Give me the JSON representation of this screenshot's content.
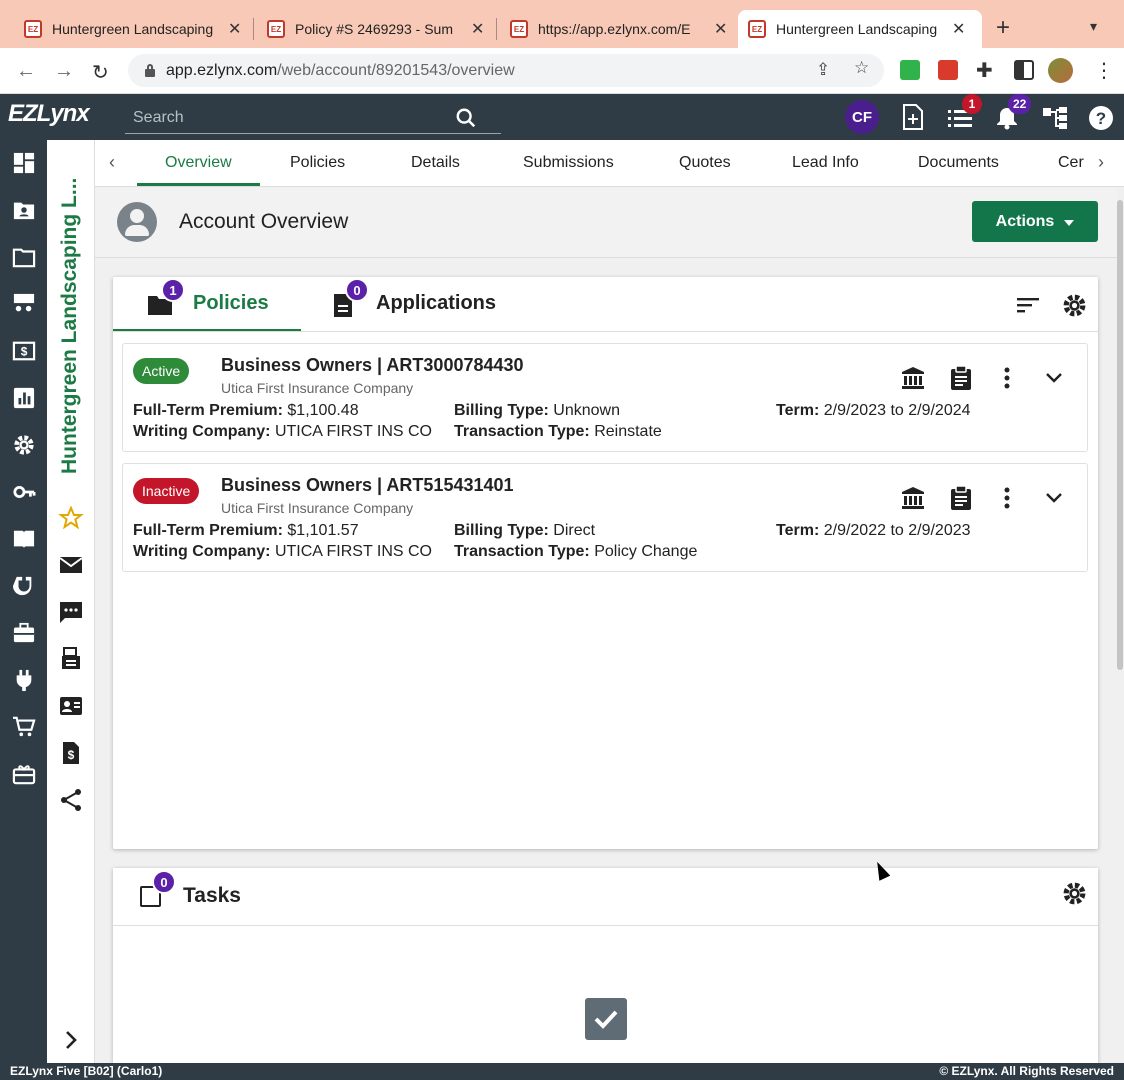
{
  "browser": {
    "tabs": [
      {
        "title": "Huntergreen Landscaping",
        "favicon": "EZ"
      },
      {
        "title": "Policy #S 2469293 - Sum",
        "favicon": "EZ"
      },
      {
        "title": "https://app.ezlynx.com/E",
        "favicon": "EZ"
      },
      {
        "title": "Huntergreen Landscaping",
        "favicon": "EZ"
      }
    ],
    "url_host": "app.ezlynx.com",
    "url_path": "/web/account/89201543/overview"
  },
  "header": {
    "logo": "EZLynx",
    "search_placeholder": "Search",
    "user_initials": "CF",
    "tasks_badge": "1",
    "notifications_badge": "22"
  },
  "account": {
    "name": "Huntergreen Landscaping L..."
  },
  "page_tabs": [
    "Overview",
    "Policies",
    "Details",
    "Submissions",
    "Quotes",
    "Lead Info",
    "Documents",
    "Cer"
  ],
  "overview": {
    "title": "Account Overview",
    "actions_label": "Actions"
  },
  "panel": {
    "policies_label": "Policies",
    "policies_count": "1",
    "applications_label": "Applications",
    "applications_count": "0"
  },
  "policies": [
    {
      "status": "Active",
      "title": "Business Owners | ART3000784430",
      "carrier": "Utica First Insurance Company",
      "premium_label": "Full-Term Premium:",
      "premium": "$1,100.48",
      "writing_label": "Writing Company:",
      "writing_company": "UTICA FIRST INS CO",
      "billing_label": "Billing Type:",
      "billing_type": "Unknown",
      "transaction_label": "Transaction Type:",
      "transaction_type": "Reinstate",
      "term_label": "Term:",
      "term": "2/9/2023 to 2/9/2024"
    },
    {
      "status": "Inactive",
      "title": "Business Owners | ART515431401",
      "carrier": "Utica First Insurance Company",
      "premium_label": "Full-Term Premium:",
      "premium": "$1,101.57",
      "writing_label": "Writing Company:",
      "writing_company": "UTICA FIRST INS CO",
      "billing_label": "Billing Type:",
      "billing_type": "Direct",
      "transaction_label": "Transaction Type:",
      "transaction_type": "Policy Change",
      "term_label": "Term:",
      "term": "2/9/2022 to 2/9/2023"
    }
  ],
  "tasks": {
    "title": "Tasks",
    "count": "0"
  },
  "footer": {
    "left": "EZLynx Five [B02] (Carlo1)",
    "right": "© EZLynx. All Rights Reserved"
  },
  "colors": {
    "brand_green": "#1c7a45",
    "header_dark": "#2f3c45",
    "badge_purple": "#5b21a8",
    "active_green": "#2e8b3a",
    "inactive_red": "#c4162a",
    "alert_red": "#c4162a"
  }
}
